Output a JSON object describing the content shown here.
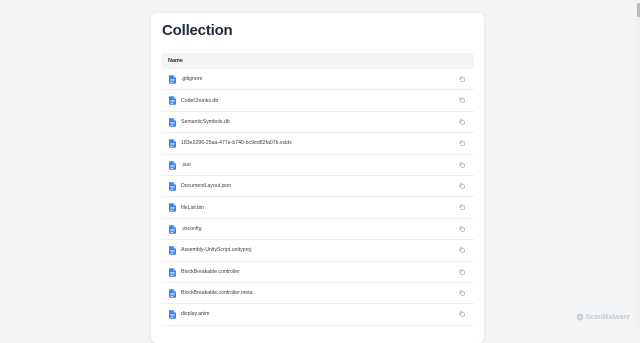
{
  "page": {
    "title": "Collection",
    "header_column": "Name"
  },
  "files": [
    {
      "name": ".gitignore"
    },
    {
      "name": "CodeChunks.db"
    },
    {
      "name": "SemanticSymbols.db"
    },
    {
      "name": "183e2296-25aa-477e-b740-bc9ed82fa07b.vsidx"
    },
    {
      "name": ".suo"
    },
    {
      "name": "DocumentLayout.json"
    },
    {
      "name": "fileList.bin"
    },
    {
      "name": ".vsconfig"
    },
    {
      "name": "Assembly-UnityScript.unityproj"
    },
    {
      "name": "BlockBreakable.controller"
    },
    {
      "name": "BlockBreakable.controller.meta"
    },
    {
      "name": "display.anim"
    }
  ],
  "icons": {
    "file": "file-icon",
    "copy": "copy-icon",
    "brand": "scanmalware-logo"
  },
  "colors": {
    "file_icon": "#3b82f6",
    "copy_icon": "#9ca3af",
    "watermark": "#c5cbd3"
  },
  "watermark": {
    "text": "ScanMalware"
  }
}
